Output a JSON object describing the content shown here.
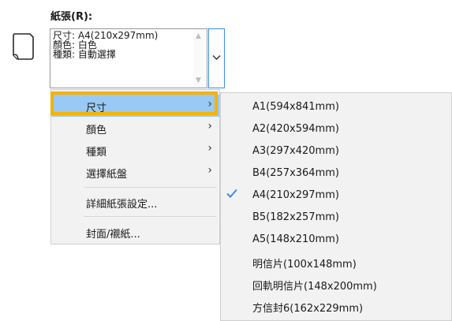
{
  "paper_group": {
    "label": "紙張(R):",
    "summary": {
      "size": "尺寸: A4(210x297mm)",
      "color": "顏色: 白色",
      "type": "種類: 自動選擇"
    }
  },
  "menu": {
    "items": [
      {
        "label": "尺寸",
        "has_submenu": true,
        "highlighted": true
      },
      {
        "label": "顏色",
        "has_submenu": true
      },
      {
        "label": "種類",
        "has_submenu": true
      },
      {
        "label": "選擇紙盤",
        "has_submenu": true
      },
      {
        "label": "詳細紙張設定..."
      },
      {
        "label": "封面/襯紙..."
      }
    ]
  },
  "submenu": {
    "items": [
      {
        "label": "A1(594x841mm)"
      },
      {
        "label": "A2(420x594mm)"
      },
      {
        "label": "A3(297x420mm)"
      },
      {
        "label": "B4(257x364mm)"
      },
      {
        "label": "A4(210x297mm)",
        "checked": true
      },
      {
        "label": "B5(182x257mm)"
      },
      {
        "label": "A5(148x210mm)"
      },
      {
        "label": "明信片(100x148mm)"
      },
      {
        "label": "回軌明信片(148x200mm)"
      },
      {
        "label": "方信封6(162x229mm)"
      }
    ]
  },
  "colors": {
    "highlight": "#99c9f5",
    "highlight_frame": "#f6b300",
    "check": "#3c8ce6",
    "dropdown_border": "#3c8ce6"
  }
}
